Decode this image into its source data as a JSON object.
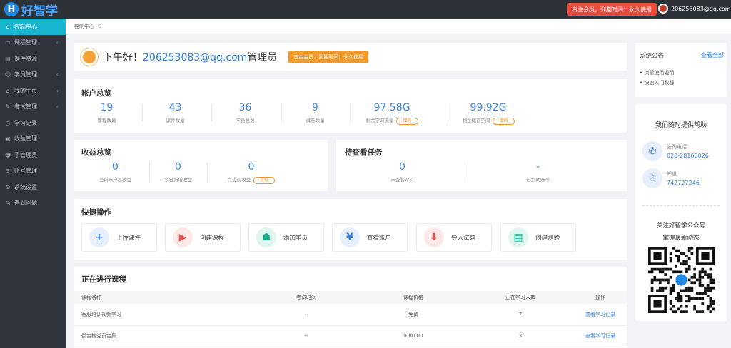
{
  "app": {
    "logo_letter": "H",
    "logo_text": "好智学"
  },
  "topbar": {
    "vip_label": "白金会员，到期时间：永久使用",
    "user_email": "206253083@qq.com",
    "caret": "⌄"
  },
  "sidebar": {
    "items": [
      {
        "label": "控制中心",
        "icon": "home-icon",
        "glyph": "⌂",
        "active": true,
        "arrow": ""
      },
      {
        "label": "课程管理",
        "icon": "book-icon",
        "glyph": "▭",
        "active": false,
        "arrow": "‹"
      },
      {
        "label": "课件资源",
        "icon": "folder-icon",
        "glyph": "▤",
        "active": false,
        "arrow": ""
      },
      {
        "label": "学员管理",
        "icon": "users-icon",
        "glyph": "☺",
        "active": false,
        "arrow": "‹"
      },
      {
        "label": "我的主页",
        "icon": "home-page-icon",
        "glyph": "⌂",
        "active": false,
        "arrow": "‹"
      },
      {
        "label": "考试管理",
        "icon": "exam-icon",
        "glyph": "✎",
        "active": false,
        "arrow": "‹"
      },
      {
        "label": "学习记录",
        "icon": "record-icon",
        "glyph": "◷",
        "active": false,
        "arrow": ""
      },
      {
        "label": "收益管理",
        "icon": "wallet-icon",
        "glyph": "▣",
        "active": false,
        "arrow": ""
      },
      {
        "label": "子管理员",
        "icon": "admin-icon",
        "glyph": "☻",
        "active": false,
        "arrow": ""
      },
      {
        "label": "账号管理",
        "icon": "dollar-icon",
        "glyph": "$",
        "active": false,
        "arrow": ""
      },
      {
        "label": "系统设置",
        "icon": "gear-icon",
        "glyph": "⚙",
        "active": false,
        "arrow": ""
      },
      {
        "label": "遇到问题",
        "icon": "help-icon",
        "glyph": "◎",
        "active": false,
        "arrow": ""
      }
    ]
  },
  "breadcrumb": {
    "label": "控制中心"
  },
  "greeting": {
    "prefix": "下午好！",
    "email": "206253083@qq.com",
    "suffix": "管理员",
    "badge": "白金会员，到期时间：永久使用"
  },
  "account": {
    "title": "账户总览",
    "stats": [
      {
        "value": "19",
        "label": "课程数量"
      },
      {
        "value": "43",
        "label": "课件数量"
      },
      {
        "value": "36",
        "label": "学员总数"
      },
      {
        "value": "9",
        "label": "试卷数量"
      },
      {
        "value": "97.58G",
        "label": "剩余学习流量",
        "action": "增购"
      },
      {
        "value": "99.92G",
        "label": "剩余储存空间",
        "action": "增购"
      }
    ]
  },
  "income": {
    "title": "收益总览",
    "stats": [
      {
        "value": "0",
        "label": "当前账户总收益"
      },
      {
        "value": "0",
        "label": "今日新增收益"
      },
      {
        "value": "0",
        "label": "可提现收益",
        "action": "提现"
      }
    ]
  },
  "pending": {
    "title": "待查看任务",
    "stats": [
      {
        "value": "0",
        "label": "未查看评价"
      },
      {
        "value": "-",
        "label": "已到期账号"
      }
    ]
  },
  "quick": {
    "title": "快捷操作",
    "actions": [
      {
        "label": "上传课件",
        "glyph": "+",
        "color": "#3b7be5",
        "bg": "#e6efff"
      },
      {
        "label": "创建课程",
        "glyph": "▶",
        "color": "#e05252",
        "bg": "#fde8e8"
      },
      {
        "label": "添加学员",
        "glyph": "☗",
        "color": "#16a78a",
        "bg": "#dff6ef"
      },
      {
        "label": "查看账户",
        "glyph": "¥",
        "color": "#3b7be5",
        "bg": "#e6efff"
      },
      {
        "label": "导入试题",
        "glyph": "⬇",
        "color": "#e05252",
        "bg": "#fde8e8"
      },
      {
        "label": "创建测验",
        "glyph": "▤",
        "color": "#16a78a",
        "bg": "#dff6ef"
      }
    ]
  },
  "courses": {
    "title": "正在进行课程",
    "columns": [
      "课程名称",
      "考试时间",
      "课程价格",
      "正在学习人数",
      "操作"
    ],
    "rows": [
      {
        "name": "客服培训视频学习",
        "exam_time": "--",
        "price": "免费",
        "learners": "7",
        "action": "查看学习记录"
      },
      {
        "name": "御合格党员合集",
        "exam_time": "--",
        "price": "¥ 80.00",
        "learners": "3",
        "action": "查看学习记录"
      }
    ]
  },
  "notice": {
    "title": "系统公告",
    "more": "查看全部",
    "items": [
      "流量使用说明",
      "快速入门教程"
    ]
  },
  "help": {
    "title": "我们随时提供帮助",
    "phone_label": "咨询电话",
    "phone": "020-28165026",
    "qq_label": "知道",
    "qq": "742727246",
    "wechat_line1": "关注好智学公众号",
    "wechat_line2": "掌握最新动态"
  }
}
